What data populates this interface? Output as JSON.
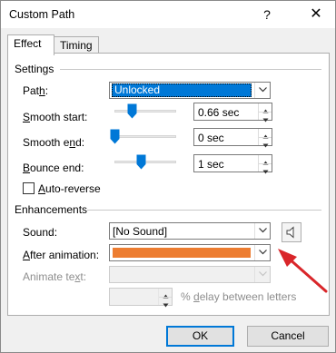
{
  "window": {
    "title": "Custom Path",
    "help": "?",
    "close": "✕"
  },
  "tabs": [
    {
      "label": "Effect",
      "active": true
    },
    {
      "label": "Timing",
      "active": false
    }
  ],
  "settings": {
    "group_label": "Settings",
    "path": {
      "label_pre": "Pat",
      "label_ul": "h",
      "label_post": ":",
      "value": "Unlocked"
    },
    "smooth_start": {
      "label_pre": "",
      "label_ul": "S",
      "label_post": "mooth start:",
      "value": "0.66 sec",
      "level": 0.33
    },
    "smooth_end": {
      "label_pre": "Smooth e",
      "label_ul": "n",
      "label_post": "d:",
      "value": "0 sec",
      "level": 0.0
    },
    "bounce_end": {
      "label_pre": "",
      "label_ul": "B",
      "label_post": "ounce end:",
      "value": "1 sec",
      "level": 0.5
    },
    "auto_reverse": {
      "label_pre": "",
      "label_ul": "A",
      "label_post": "uto-reverse",
      "checked": false
    }
  },
  "enhancements": {
    "group_label": "Enhancements",
    "sound": {
      "label": "Sound:",
      "value": "[No Sound]"
    },
    "after_animation": {
      "label_pre": "",
      "label_ul": "A",
      "label_post": "fter animation:",
      "color": "#ed7d31"
    },
    "animate_text": {
      "label_pre": "Animate te",
      "label_ul": "x",
      "label_post": "t:",
      "value": ""
    },
    "delay": {
      "value": "",
      "label_pre": "% ",
      "label_ul": "d",
      "label_post": "elay between letters"
    }
  },
  "footer": {
    "ok": "OK",
    "cancel": "Cancel"
  },
  "colors": {
    "accent": "#0078d7",
    "annotation_arrow": "#d9262a",
    "orange": "#ed7d31"
  },
  "icons": {
    "sound": "speaker-icon",
    "dropdown": "chevron-down-icon"
  }
}
